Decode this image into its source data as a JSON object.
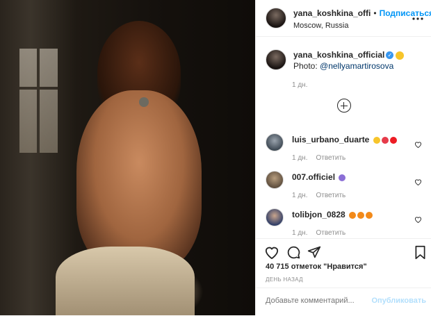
{
  "header": {
    "username": "yana_koshkina_offi",
    "dot": "•",
    "follow_label": "Подписаться",
    "location": "Moscow, Russia",
    "more_icon": "more-horizontal-icon"
  },
  "caption": {
    "username": "yana_koshkina_official",
    "verified_icon": "verified-badge-icon",
    "emoji": "face-emoji",
    "photo_prefix": "Photo: ",
    "mention": "@nellyamartirosova",
    "time": "1 дн."
  },
  "load_more_icon": "plus-circle-icon",
  "comments": [
    {
      "username": "luis_urbano_duarte",
      "emojis": [
        "#f7c52b",
        "#e63b4a",
        "#ed1c24"
      ],
      "time": "1 дн.",
      "reply": "Ответить"
    },
    {
      "username": "007.officiel",
      "emojis": [
        "#8b6fd6"
      ],
      "time": "1 дн.",
      "reply": "Ответить"
    },
    {
      "username": "tolibjon_0828",
      "emojis": [
        "#f28a1a",
        "#f28a1a",
        "#f28a1a"
      ],
      "time": "1 дн.",
      "reply": "Ответить"
    }
  ],
  "actions": {
    "like_icon": "heart-icon",
    "comment_icon": "comment-icon",
    "share_icon": "paper-plane-icon",
    "save_icon": "bookmark-icon"
  },
  "likes": "40 715 отметок \"Нравится\"",
  "posted_ago": "ДЕНЬ НАЗАД",
  "add_comment": {
    "placeholder": "Добавьте комментарий...",
    "publish_label": "Опубликовать"
  },
  "colors": {
    "accent": "#0095f6",
    "publish_disabled": "#b2dffc",
    "muted": "#8e8e8e",
    "text": "#262626"
  }
}
